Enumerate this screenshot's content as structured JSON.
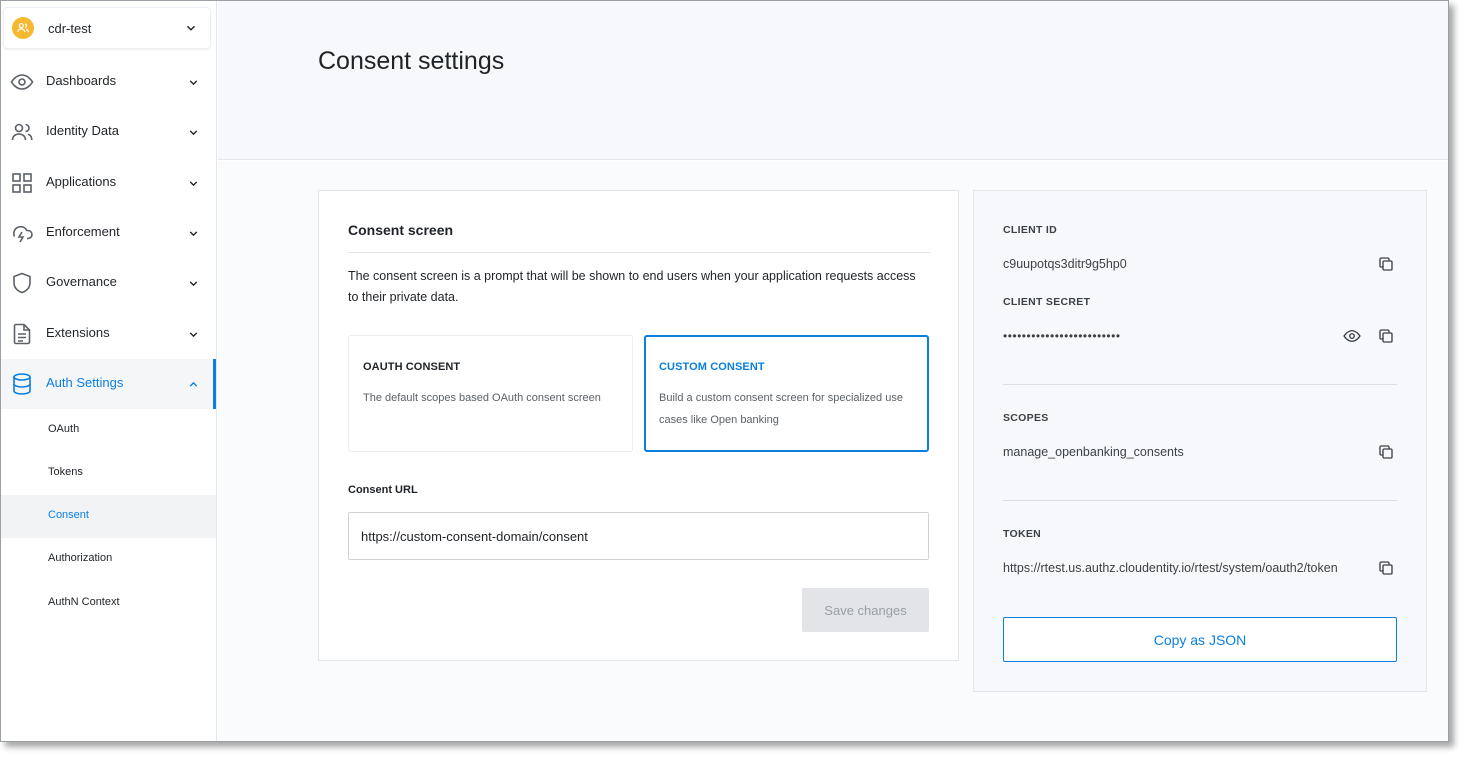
{
  "tenant": {
    "name": "cdr-test",
    "icon": "users-icon"
  },
  "sidebar": {
    "items": [
      {
        "label": "Dashboards",
        "icon": "eye-icon"
      },
      {
        "label": "Identity Data",
        "icon": "users-icon"
      },
      {
        "label": "Applications",
        "icon": "grid-icon"
      },
      {
        "label": "Enforcement",
        "icon": "cloud-lightning-icon"
      },
      {
        "label": "Governance",
        "icon": "shield-icon"
      },
      {
        "label": "Extensions",
        "icon": "document-icon"
      },
      {
        "label": "Auth Settings",
        "icon": "database-icon",
        "active": true,
        "expanded": true
      }
    ],
    "subitems": [
      {
        "label": "OAuth"
      },
      {
        "label": "Tokens"
      },
      {
        "label": "Consent",
        "active": true
      },
      {
        "label": "Authorization"
      },
      {
        "label": "AuthN Context"
      }
    ]
  },
  "page": {
    "title": "Consent settings"
  },
  "consent": {
    "title": "Consent screen",
    "description": "The consent screen is a prompt that will be shown to end users when your application requests access to their private data.",
    "options": [
      {
        "title": "OAUTH CONSENT",
        "description": "The default scopes based OAuth consent screen",
        "selected": false
      },
      {
        "title": "CUSTOM CONSENT",
        "description": "Build a custom consent screen for specialized use cases like Open banking",
        "selected": true
      }
    ],
    "url_label": "Consent URL",
    "url_value": "https://custom-consent-domain/consent",
    "save_label": "Save changes"
  },
  "info": {
    "client_id_label": "CLIENT ID",
    "client_id": "c9uupotqs3ditr9g5hp0",
    "client_secret_label": "CLIENT SECRET",
    "client_secret": "•••••••••••••••••••••••••",
    "scopes_label": "SCOPES",
    "scopes": "manage_openbanking_consents",
    "token_label": "TOKEN",
    "token": "https://rtest.us.authz.cloudentity.io/rtest/system/oauth2/token",
    "copy_json_label": "Copy as JSON"
  },
  "colors": {
    "accent": "#0b7fe0",
    "tenant_avatar": "#f5b82e",
    "header_bg": "#f7f8fc"
  }
}
